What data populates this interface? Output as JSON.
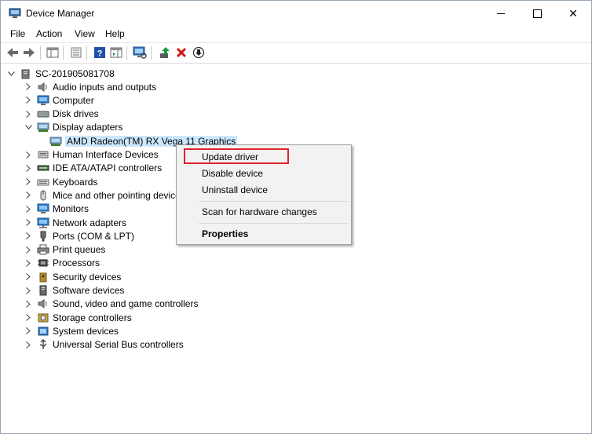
{
  "window": {
    "title": "Device Manager"
  },
  "titlebar_controls": {
    "minimize": "—",
    "maximize": "☐",
    "close": "✕"
  },
  "menu": [
    "File",
    "Action",
    "View",
    "Help"
  ],
  "toolbar": {
    "buttons": [
      "back-icon",
      "forward-icon",
      "properties-pane-icon",
      "device-list-icon",
      "help-icon",
      "action-pane-icon",
      "scan-hardware-icon",
      "update-driver-icon",
      "uninstall-icon",
      "disable-icon"
    ]
  },
  "tree": {
    "root": "SC-201905081708",
    "items": [
      {
        "label": "Audio inputs and outputs",
        "icon": "speaker-icon"
      },
      {
        "label": "Computer",
        "icon": "computer-icon"
      },
      {
        "label": "Disk drives",
        "icon": "disk-icon"
      },
      {
        "label": "Display adapters",
        "icon": "display-adapter-icon",
        "expanded": true,
        "children": [
          {
            "label": "AMD Radeon(TM) RX Vega 11 Graphics",
            "icon": "display-adapter-icon",
            "selected": true
          }
        ]
      },
      {
        "label": "Human Interface Devices",
        "icon": "hid-icon"
      },
      {
        "label": "IDE ATA/ATAPI controllers",
        "icon": "ide-icon"
      },
      {
        "label": "Keyboards",
        "icon": "keyboard-icon"
      },
      {
        "label": "Mice and other pointing devices",
        "icon": "mouse-icon"
      },
      {
        "label": "Monitors",
        "icon": "monitor-icon"
      },
      {
        "label": "Network adapters",
        "icon": "network-icon"
      },
      {
        "label": "Ports (COM & LPT)",
        "icon": "port-icon"
      },
      {
        "label": "Print queues",
        "icon": "printer-icon"
      },
      {
        "label": "Processors",
        "icon": "processor-icon"
      },
      {
        "label": "Security devices",
        "icon": "security-icon"
      },
      {
        "label": "Software devices",
        "icon": "software-icon"
      },
      {
        "label": "Sound, video and game controllers",
        "icon": "sound-icon"
      },
      {
        "label": "Storage controllers",
        "icon": "storage-icon"
      },
      {
        "label": "System devices",
        "icon": "system-icon"
      },
      {
        "label": "Universal Serial Bus controllers",
        "icon": "usb-icon"
      }
    ]
  },
  "context_menu": {
    "items": [
      {
        "label": "Update driver",
        "highlighted": true
      },
      {
        "label": "Disable device"
      },
      {
        "label": "Uninstall device"
      },
      {
        "label": "Scan for hardware changes"
      },
      {
        "label": "Properties",
        "bold": true
      }
    ]
  },
  "colors": {
    "selection": "#cce8ff",
    "highlight_border": "#e0232b",
    "help_blue": "#1f4fa8",
    "uninstall_red": "#d01818",
    "update_green": "#1d9a3b"
  }
}
